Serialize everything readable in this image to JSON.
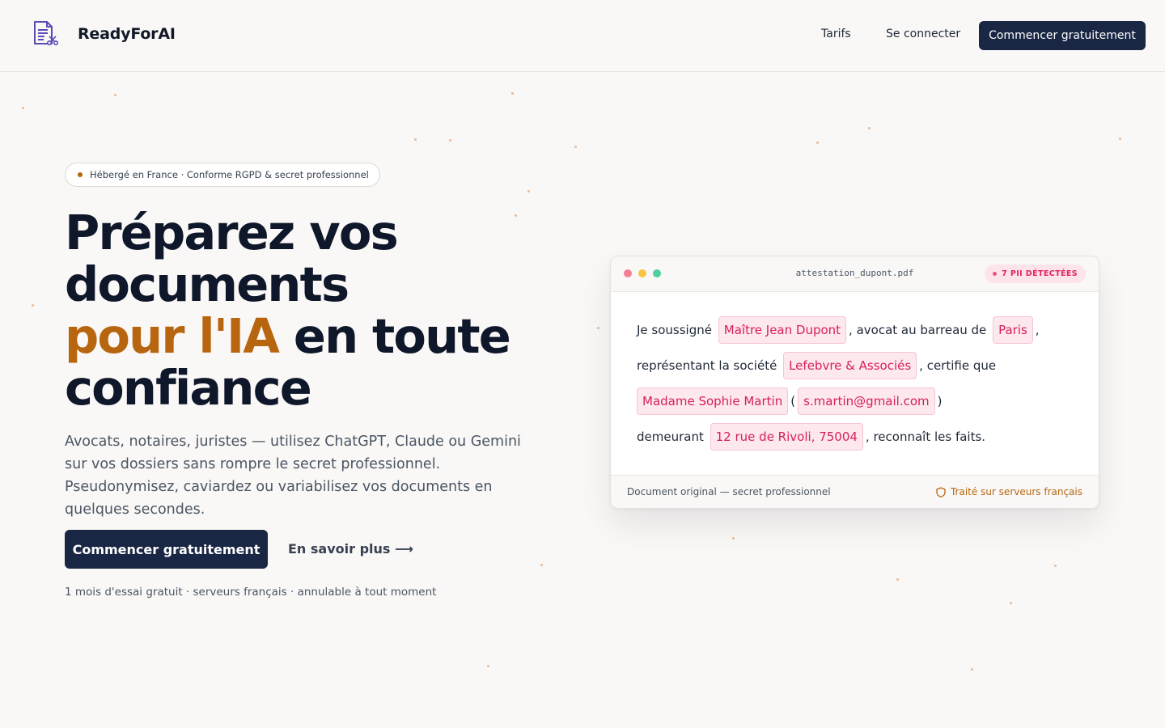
{
  "header": {
    "brand": "ReadyForAI",
    "nav": {
      "pricing": "Tarifs",
      "login": "Se connecter",
      "cta": "Commencer gratuitement"
    }
  },
  "hero": {
    "badge": "Hébergé en France · Conforme RGPD & secret professionnel",
    "title_line1": "Préparez vos",
    "title_line2": "documents",
    "title_accent": "pour l'IA",
    "title_after_accent": " en toute",
    "title_line4": "confiance",
    "lede": "Avocats, notaires, juristes — utilisez ChatGPT, Claude ou Gemini sur vos dossiers sans rompre le secret professionnel. Pseudonymisez, caviardez ou variabilisez vos documents en quelques secondes.",
    "cta_primary": "Commencer gratuitement",
    "cta_secondary": "En savoir plus ⟶",
    "fine_print": "1 mois d'essai gratuit · serveurs français · annulable à tout moment"
  },
  "doc_card": {
    "filename": "attestation_dupont.pdf",
    "pii_badge": "7 PII DÉTECTÉES",
    "lines": [
      {
        "t1": "Je soussigné",
        "p1": "Maître Jean Dupont",
        "t2": ", avocat au barreau de",
        "p2": "Paris",
        "t3": ","
      },
      {
        "t1": "représentant la société",
        "p1": "Lefebvre & Associés",
        "t2": ", certifie que"
      },
      {
        "p1": "Madame Sophie Martin",
        "t1": "(",
        "p2": "s.martin@gmail.com",
        "t2": ")"
      },
      {
        "t1": "demeurant",
        "p1": "12 rue de Rivoli, 75004",
        "t2": ", reconnaît les faits."
      }
    ],
    "footer_left": "Document original — secret professionnel",
    "footer_right": "Traité sur serveurs français"
  },
  "icons": {
    "logo": "document-scissors-icon",
    "shield": "shield-icon"
  },
  "colors": {
    "navy": "#1a2744",
    "accent": "#b8650f",
    "pii_bg": "#fde8ed",
    "pii_text": "#d61f5b"
  }
}
